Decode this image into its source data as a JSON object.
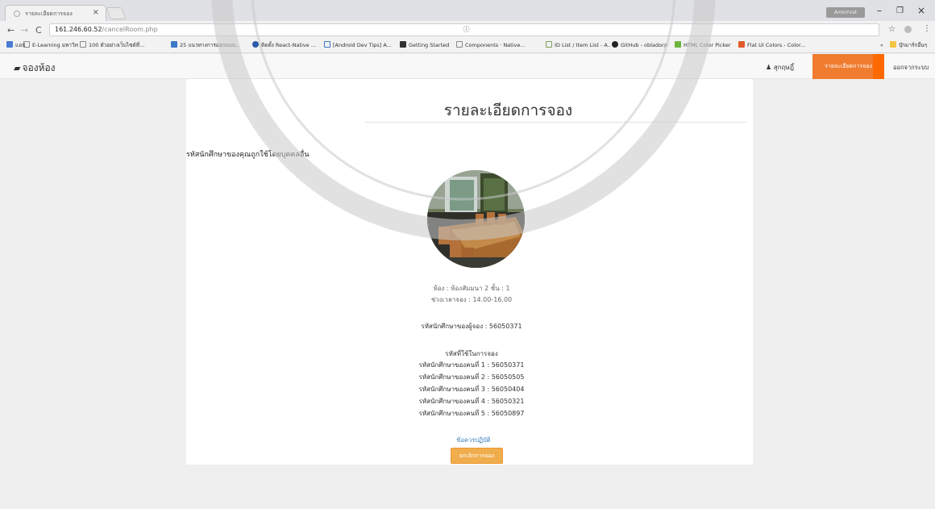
{
  "browser": {
    "tab_title": "รายละเอียดการจอง",
    "tab_close": "×",
    "profile_badge": "Amornrat",
    "window_minimize": "–",
    "window_restore": "❐",
    "window_close": "×",
    "url_host": "161.246.60.52",
    "url_path": "/cancelRoom.php",
    "bookmarks": [
      "แอป",
      "E-Learning มหาวิทยาลัย",
      "100 ตัวอย่างเว็บไซต์ที่...",
      "25 แนวทางการออกแบบ...",
      "ติดตั้ง React-Native ...",
      "[Android Dev Tips] A...",
      "Getting Started",
      "Components · Native...",
      "ID List / Item List - A...",
      "GitHub - oblador/re...",
      "HTML Color Picker",
      "Flat UI Colors - Color...",
      "บุ๊กมาร์กอื่นๆ"
    ],
    "bookmarks_more": "»",
    "colors": {
      "tab_bg": "#f2f2f2",
      "chrome_bg": "#dfe1e5"
    }
  },
  "navbar": {
    "brand": "จองห้อง",
    "brand_icon": "book-icon",
    "user_icon": "user-icon",
    "user_label": "สุกฤษฎิ์",
    "active_item": "รายละเอียดการจอง",
    "logout": "ออกจากระบบ",
    "colors": {
      "active_bg": "#f07c30",
      "active_edge": "#ff6a00"
    }
  },
  "main": {
    "title": "รายละเอียดการจอง",
    "warning": "รหัสนักศึกษาของคุณถูกใช้โดยบุคคลอื่น",
    "room_image": "meeting-room-photo",
    "room_label": "ห้อง : ห้องสัมมนา 2 ชั้น : 1",
    "time_label": "ช่วงเวลาจอง : 14.00-16.00",
    "booker_label": "รหัสนักศึกษาของผู้จอง : 56050371",
    "used_ids_heading": "รหัสที่ใช้ในการจอง",
    "used_ids": [
      "รหัสนักศึกษาของคนที่ 1 : 56050371",
      "รหัสนักศึกษาของคนที่ 2 : 56050505",
      "รหัสนักศึกษาของคนที่ 3 : 56050404",
      "รหัสนักศึกษาของคนที่ 4 : 56050321",
      "รหัสนักศึกษาของคนที่ 5 : 56050897"
    ],
    "rules_link": "ข้อควรปฏิบัติ",
    "cancel_button": "ยกเลิกการจอง",
    "colors": {
      "button": "#f0ad4e",
      "link": "#337ab7"
    }
  }
}
